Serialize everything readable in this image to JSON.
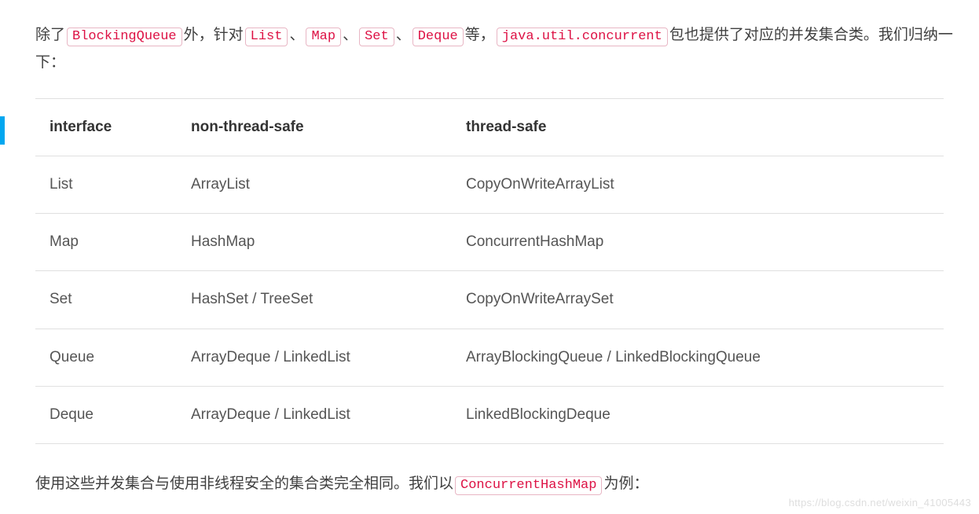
{
  "intro": {
    "text_before_code1": "除了",
    "code1": "BlockingQueue",
    "text_after_code1": "外，针对",
    "code2": "List",
    "sep1": "、",
    "code3": "Map",
    "sep2": "、",
    "code4": "Set",
    "sep3": "、",
    "code5": "Deque",
    "text_after_code5": "等，",
    "code6": "java.util.concurrent",
    "text_after_code6": "包也提供了对应的并发集合类。我们归纳一下："
  },
  "table": {
    "headers": {
      "h1": "interface",
      "h2": "non-thread-safe",
      "h3": "thread-safe"
    },
    "rows": [
      {
        "c1": "List",
        "c2": "ArrayList",
        "c3": "CopyOnWriteArrayList"
      },
      {
        "c1": "Map",
        "c2": "HashMap",
        "c3": "ConcurrentHashMap"
      },
      {
        "c1": "Set",
        "c2": "HashSet / TreeSet",
        "c3": "CopyOnWriteArraySet"
      },
      {
        "c1": "Queue",
        "c2": "ArrayDeque / LinkedList",
        "c3": "ArrayBlockingQueue / LinkedBlockingQueue"
      },
      {
        "c1": "Deque",
        "c2": "ArrayDeque / LinkedList",
        "c3": "LinkedBlockingDeque"
      }
    ]
  },
  "outro": {
    "text_before_code1": "使用这些并发集合与使用非线程安全的集合类完全相同。我们以",
    "code1": "ConcurrentHashMap",
    "text_after_code1": "为例："
  },
  "watermark": "https://blog.csdn.net/weixin_41005443"
}
